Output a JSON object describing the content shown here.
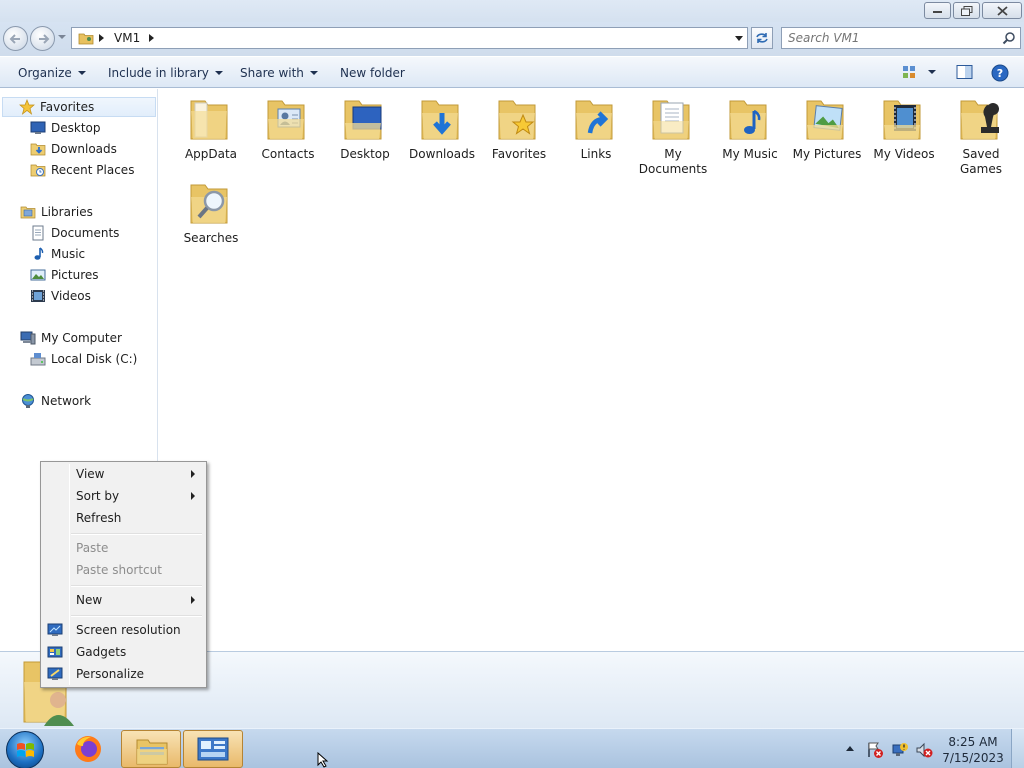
{
  "window": {
    "minimize_icon": "minimize-icon",
    "maximize_icon": "restore-icon",
    "close_icon": "close-icon"
  },
  "address": {
    "path": [
      "VM1"
    ],
    "search_placeholder": "Search VM1"
  },
  "toolbar": {
    "organize": "Organize",
    "include_in_library": "Include in library",
    "share_with": "Share with",
    "new_folder": "New folder"
  },
  "nav": {
    "favorites": {
      "label": "Favorites",
      "items": [
        "Desktop",
        "Downloads",
        "Recent Places"
      ]
    },
    "libraries": {
      "label": "Libraries",
      "items": [
        "Documents",
        "Music",
        "Pictures",
        "Videos"
      ]
    },
    "computer": {
      "label": "My Computer",
      "items": [
        "Local Disk (C:)"
      ]
    },
    "network": {
      "label": "Network"
    }
  },
  "folders": [
    {
      "line1": "AppData",
      "line2": "",
      "icon": "appdata-folder-icon"
    },
    {
      "line1": "Contacts",
      "line2": "",
      "icon": "contacts-folder-icon"
    },
    {
      "line1": "Desktop",
      "line2": "",
      "icon": "desktop-folder-icon"
    },
    {
      "line1": "Downloads",
      "line2": "",
      "icon": "downloads-folder-icon"
    },
    {
      "line1": "Favorites",
      "line2": "",
      "icon": "favorites-folder-icon"
    },
    {
      "line1": "Links",
      "line2": "",
      "icon": "links-folder-icon"
    },
    {
      "line1": "My",
      "line2": "Documents",
      "icon": "documents-folder-icon"
    },
    {
      "line1": "My Music",
      "line2": "",
      "icon": "music-folder-icon"
    },
    {
      "line1": "My Pictures",
      "line2": "",
      "icon": "pictures-folder-icon"
    },
    {
      "line1": "My Videos",
      "line2": "",
      "icon": "videos-folder-icon"
    },
    {
      "line1": "Saved",
      "line2": "Games",
      "icon": "saved-games-folder-icon"
    },
    {
      "line1": "Searches",
      "line2": "",
      "icon": "searches-folder-icon"
    }
  ],
  "context_menu": {
    "view": "View",
    "sort_by": "Sort by",
    "refresh": "Refresh",
    "paste": "Paste",
    "paste_shortcut": "Paste shortcut",
    "new": "New",
    "screen_resolution": "Screen resolution",
    "gadgets": "Gadgets",
    "personalize": "Personalize"
  },
  "taskbar": {
    "time": "8:25 AM",
    "date": "7/15/2023"
  },
  "colors": {
    "folder": "#f2d27a",
    "folder_dark": "#d9ad45",
    "selection": "#e2eefb",
    "taskbar": "#b7cde6"
  }
}
